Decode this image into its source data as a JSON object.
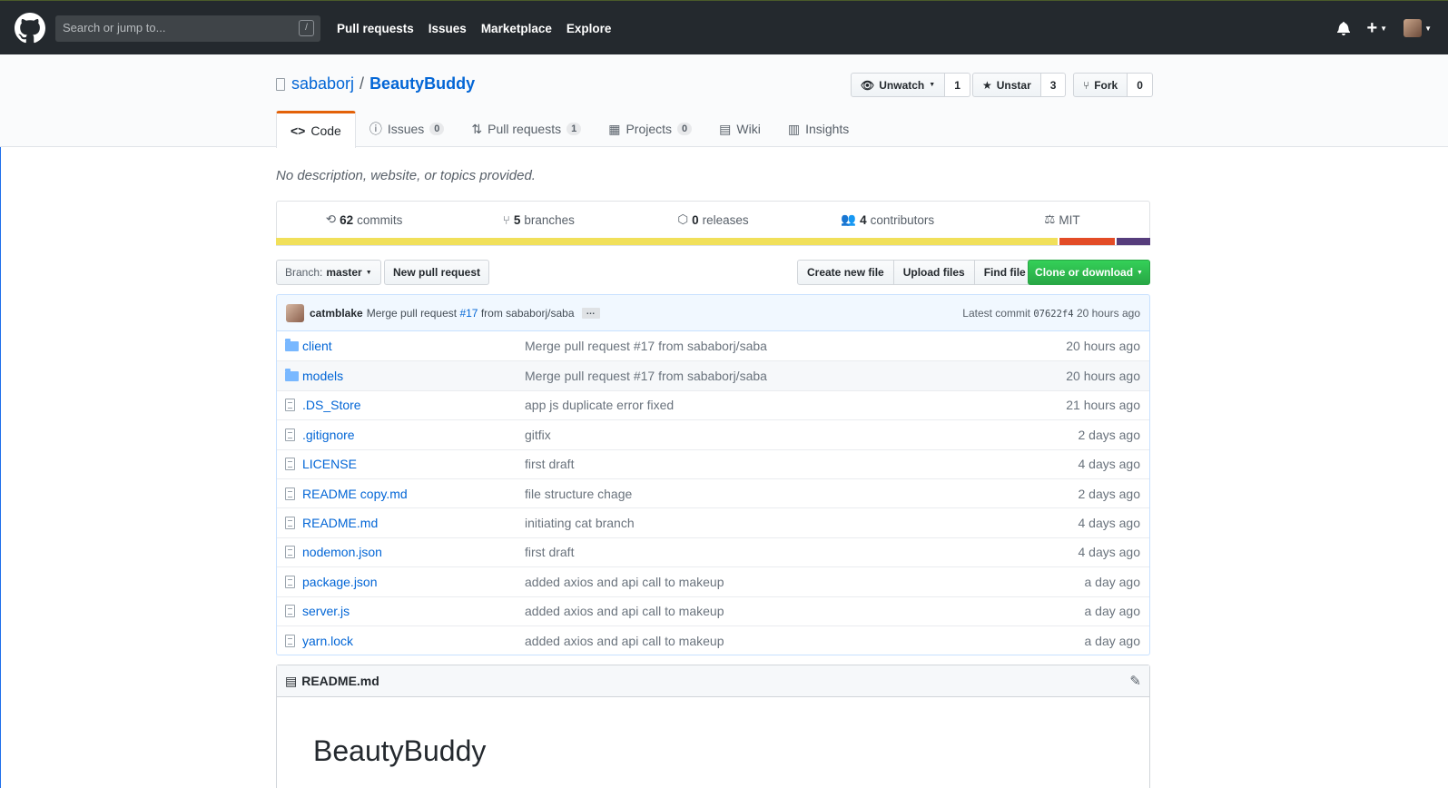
{
  "header": {
    "search_placeholder": "Search or jump to...",
    "search_shortcut": "/",
    "nav": [
      "Pull requests",
      "Issues",
      "Marketplace",
      "Explore"
    ],
    "plus": "+"
  },
  "repo": {
    "owner": "sababorj",
    "separator": "/",
    "name": "BeautyBuddy",
    "description": "No description, website, or topics provided."
  },
  "actions": {
    "watch": {
      "label": "Unwatch",
      "count": "1"
    },
    "star": {
      "label": "Unstar",
      "count": "3"
    },
    "fork": {
      "label": "Fork",
      "count": "0"
    }
  },
  "tabs": [
    {
      "label": "Code",
      "icon": "code-icon"
    },
    {
      "label": "Issues",
      "counter": "0",
      "icon": "issue-icon"
    },
    {
      "label": "Pull requests",
      "counter": "1",
      "icon": "pr-icon"
    },
    {
      "label": "Projects",
      "counter": "0",
      "icon": "project-icon"
    },
    {
      "label": "Wiki",
      "icon": "wiki-icon"
    },
    {
      "label": "Insights",
      "icon": "graph-icon"
    }
  ],
  "summary": {
    "commits_num": "62",
    "commits_label": "commits",
    "branches_num": "5",
    "branches_label": "branches",
    "releases_num": "0",
    "releases_label": "releases",
    "contributors_num": "4",
    "contributors_label": "contributors",
    "license": "MIT"
  },
  "languages": [
    {
      "color": "#f1e05a",
      "share": 0.895
    },
    {
      "color": "#e34c26",
      "share": 0.064
    },
    {
      "color": "#563d7c",
      "share": 0.038
    }
  ],
  "filenav": {
    "branch_label": "Branch:",
    "branch": "master",
    "new_pr": "New pull request",
    "create": "Create new file",
    "upload": "Upload files",
    "find": "Find file",
    "clone": "Clone or download"
  },
  "commit": {
    "author": "catmblake",
    "msg_pre": "Merge pull request",
    "pr": "#17",
    "msg_post": "from sababorj/saba",
    "ellipsis": "…",
    "latest_label": "Latest commit",
    "sha": "07622f4",
    "age": "20 hours ago"
  },
  "files": [
    {
      "name": "client",
      "type": "dir",
      "message": "Merge pull request #17 from sababorj/saba",
      "age": "20 hours ago"
    },
    {
      "name": "models",
      "type": "dir",
      "message": "Merge pull request #17 from sababorj/saba",
      "age": "20 hours ago"
    },
    {
      "name": ".DS_Store",
      "type": "file",
      "message": "app js duplicate error fixed",
      "age": "21 hours ago"
    },
    {
      "name": ".gitignore",
      "type": "file",
      "message": "gitfix",
      "age": "2 days ago"
    },
    {
      "name": "LICENSE",
      "type": "file",
      "message": "first draft",
      "age": "4 days ago"
    },
    {
      "name": "README copy.md",
      "type": "file",
      "message": "file structure chage",
      "age": "2 days ago"
    },
    {
      "name": "README.md",
      "type": "file",
      "message": "initiating cat branch",
      "age": "4 days ago"
    },
    {
      "name": "nodemon.json",
      "type": "file",
      "message": "first draft",
      "age": "4 days ago"
    },
    {
      "name": "package.json",
      "type": "file",
      "message": "added axios and api call to makeup",
      "age": "a day ago"
    },
    {
      "name": "server.js",
      "type": "file",
      "message": "added axios and api call to makeup",
      "age": "a day ago"
    },
    {
      "name": "yarn.lock",
      "type": "file",
      "message": "added axios and api call to makeup",
      "age": "a day ago"
    }
  ],
  "readme": {
    "filename": "README.md",
    "heading": "BeautyBuddy"
  }
}
